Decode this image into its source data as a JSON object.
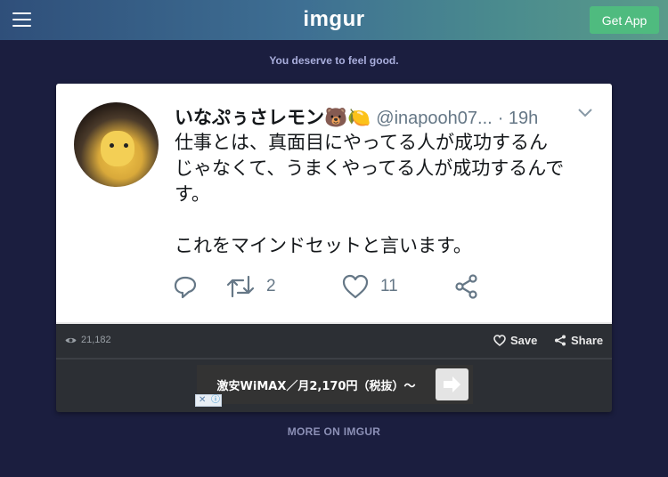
{
  "header": {
    "logo": "imgur",
    "get_app_label": "Get App",
    "tagline": "You deserve to feel good."
  },
  "tweet": {
    "display_name": "いなぷぅさレモン🐻🍋",
    "handle": "@inapooh07...",
    "time": "· 19h",
    "text_line1": "仕事とは、真面目にやってる人が成功するん",
    "text_line2": "じゃなくて、うまくやってる人が成功するんで",
    "text_line3": "す。",
    "text_line4": "これをマインドセットと言います。",
    "retweets": "2",
    "likes": "11",
    "icons": [
      "reply-icon",
      "retweet-icon",
      "heart-icon",
      "share-icon",
      "chevron-down-icon"
    ]
  },
  "post_meta": {
    "views": "21,182",
    "save_label": "Save",
    "share_label": "Share"
  },
  "ad": {
    "text": "激安WiMAX／月2,170円（税抜）〜"
  },
  "footer": {
    "more_label": "MORE ON IMGUR"
  },
  "colors": {
    "background": "#1b1e3f",
    "get_app": "#4fbb7f",
    "post_bg": "#2c2f34"
  }
}
